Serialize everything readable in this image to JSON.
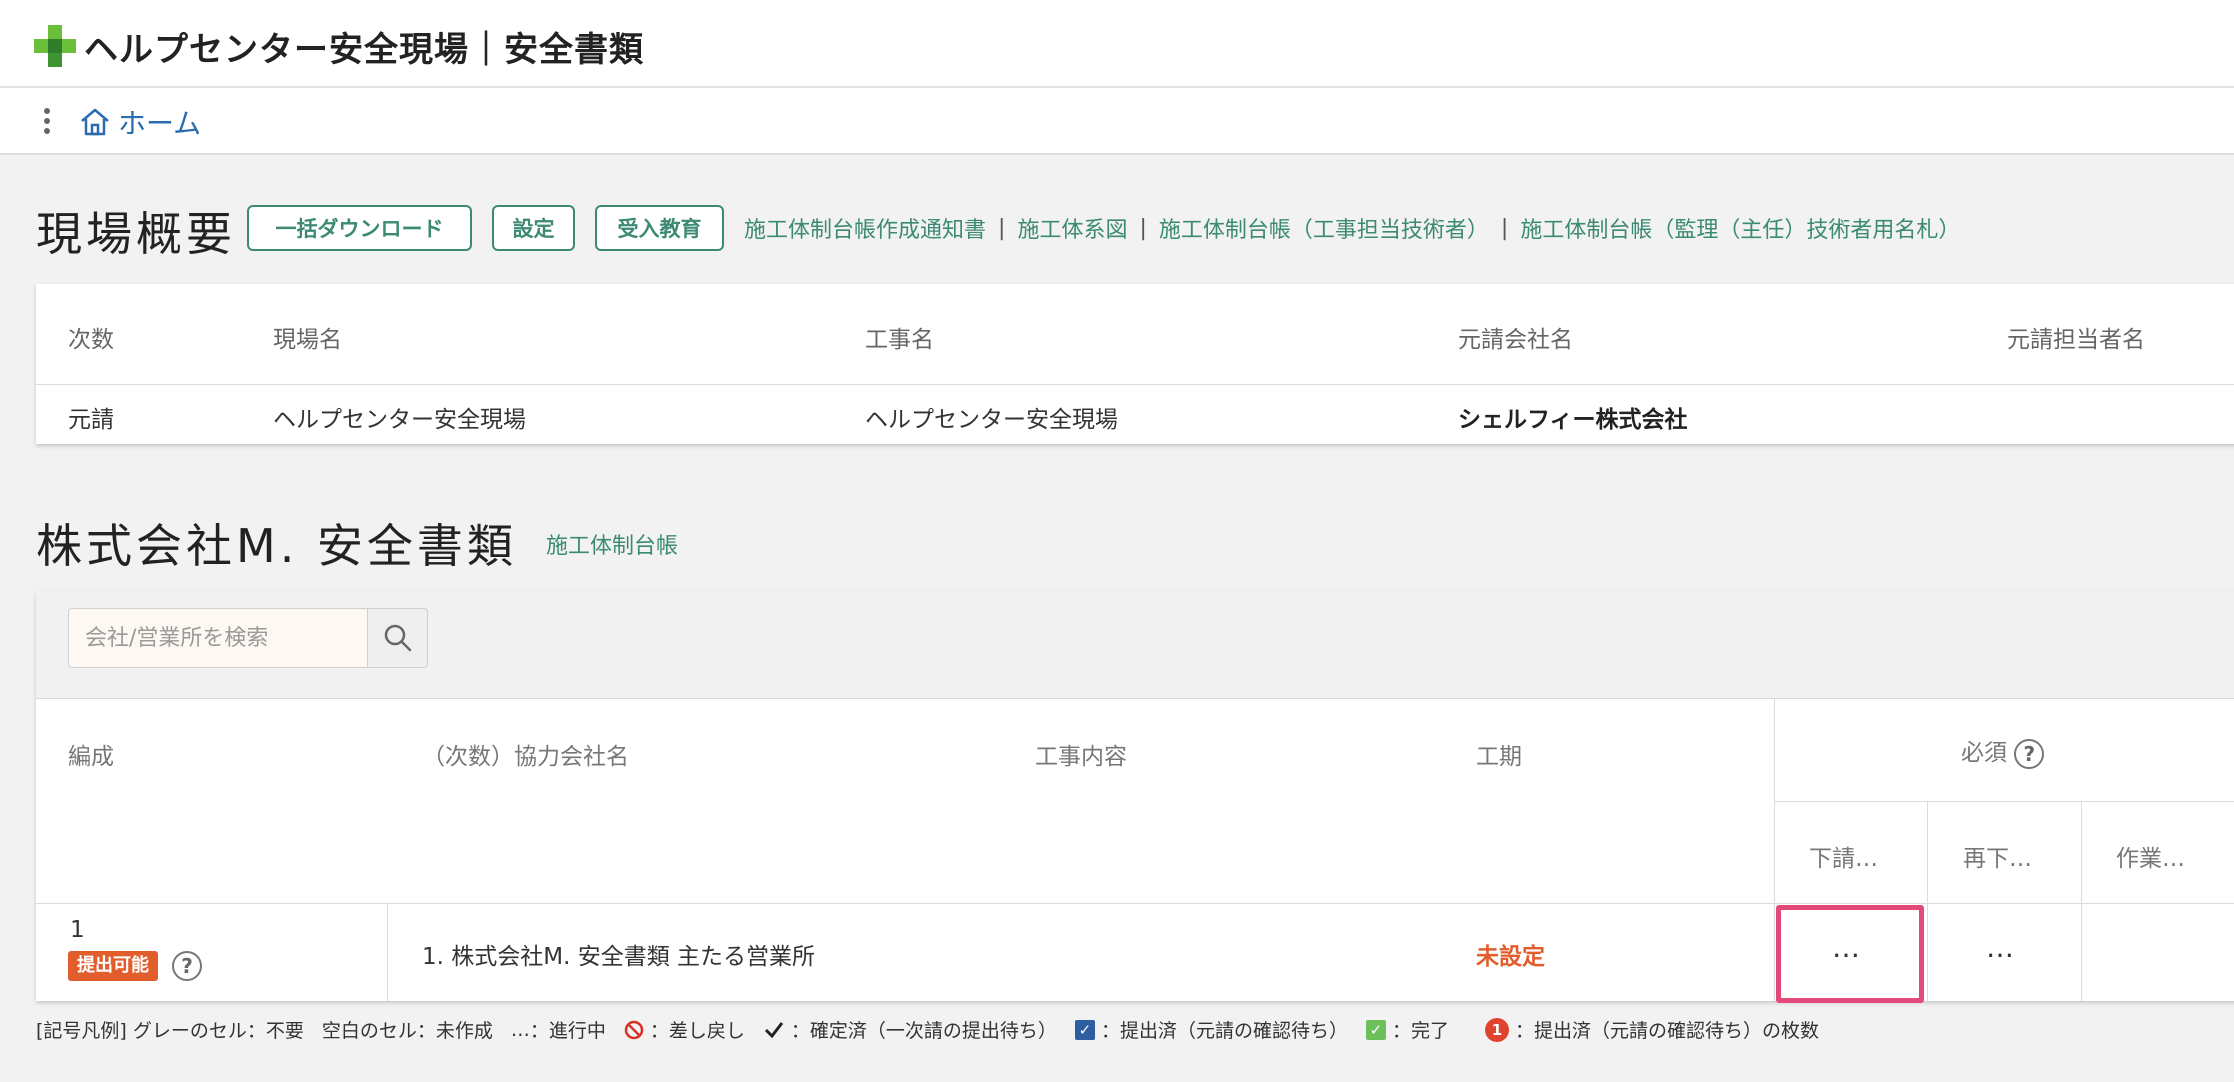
{
  "app": {
    "title": "ヘルプセンター安全現場｜安全書類"
  },
  "nav": {
    "home_label": "ホーム"
  },
  "overview": {
    "title": "現場概要",
    "buttons": {
      "bulk_download": "一括ダウンロード",
      "settings": "設定",
      "education": "受入教育"
    },
    "links": [
      "施工体制台帳作成通知書",
      "施工体系図",
      "施工体制台帳（工事担当技術者）",
      "施工体制台帳（監理（主任）技術者用名札）"
    ],
    "separator": "|",
    "table": {
      "headers": [
        "次数",
        "現場名",
        "工事名",
        "元請会社名",
        "元請担当者名"
      ],
      "row": [
        "元請",
        "ヘルプセンター安全現場",
        "ヘルプセンター安全現場",
        "シェルフィー株式会社",
        ""
      ]
    }
  },
  "documents": {
    "title": "株式会社M. 安全書類",
    "ledger_link": "施工体制台帳",
    "search": {
      "placeholder": "会社/営業所を検索"
    },
    "table": {
      "headers": {
        "composition": "編成",
        "company": "（次数）協力会社名",
        "work": "工事内容",
        "period": "工期",
        "required": "必須",
        "sub": [
          "下請…",
          "再下…",
          "作業…"
        ]
      },
      "row": {
        "number": "1",
        "badge": "提出可能",
        "company": "1. 株式会社M. 安全書類 主たる営業所",
        "work": "",
        "period": "未設定",
        "cells": [
          "…",
          "…",
          ""
        ]
      }
    }
  },
  "legend": {
    "prefix": "[記号凡例] グレーのセル：不要",
    "blank": "空白のセル：未作成",
    "progress_symbol": "…",
    "progress": "：進行中",
    "rejected": "：差し戻し",
    "confirmed": "：確定済（一次請の提出待ち）",
    "submitted": "：提出済（元請の確認待ち）",
    "done": "：完了",
    "count_symbol": "1",
    "count": "：提出済（元請の確認待ち）の枚数"
  },
  "colors": {
    "accent": "#3c8a74",
    "link_blue": "#2b6cb0",
    "alert": "#e25d2c",
    "selection": "#e44a79"
  }
}
